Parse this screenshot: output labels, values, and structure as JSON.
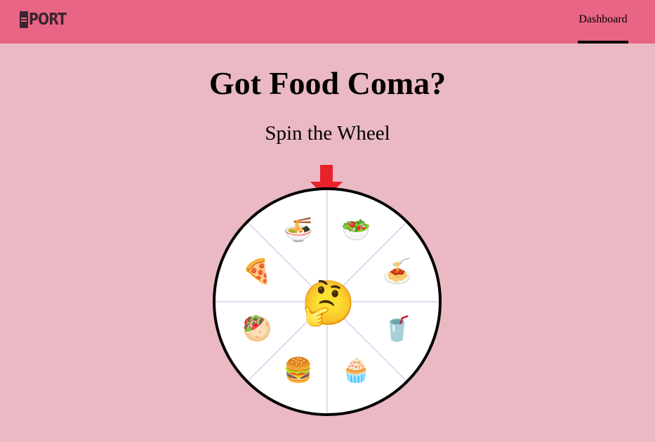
{
  "header": {
    "logo_text": "PORT",
    "nav": {
      "dashboard_label": "Dashboard"
    },
    "colors": {
      "bar": "#e96585",
      "active_underline": "#000000"
    }
  },
  "main": {
    "title": "Got Food Coma?",
    "subtitle": "Spin the Wheel"
  },
  "wheel": {
    "center_icon": "thinking-face-icon",
    "center_glyph": "🤔",
    "segments": [
      {
        "icon": "salad-icon",
        "glyph": "🥗"
      },
      {
        "icon": "spaghetti-icon",
        "glyph": "🍝"
      },
      {
        "icon": "milkshake-icon",
        "glyph": "🥤"
      },
      {
        "icon": "cupcake-icon",
        "glyph": "🧁"
      },
      {
        "icon": "burger-icon",
        "glyph": "🍔"
      },
      {
        "icon": "poke-bowl-icon",
        "glyph": "🥙"
      },
      {
        "icon": "pizza-slice-icon",
        "glyph": "🍕"
      },
      {
        "icon": "noodles-icon",
        "glyph": "🍜"
      }
    ],
    "pointer_icon": "down-arrow-icon",
    "colors": {
      "divider": "#c9b7e8",
      "rim": "#000000",
      "pointer": "#e8222a"
    }
  }
}
